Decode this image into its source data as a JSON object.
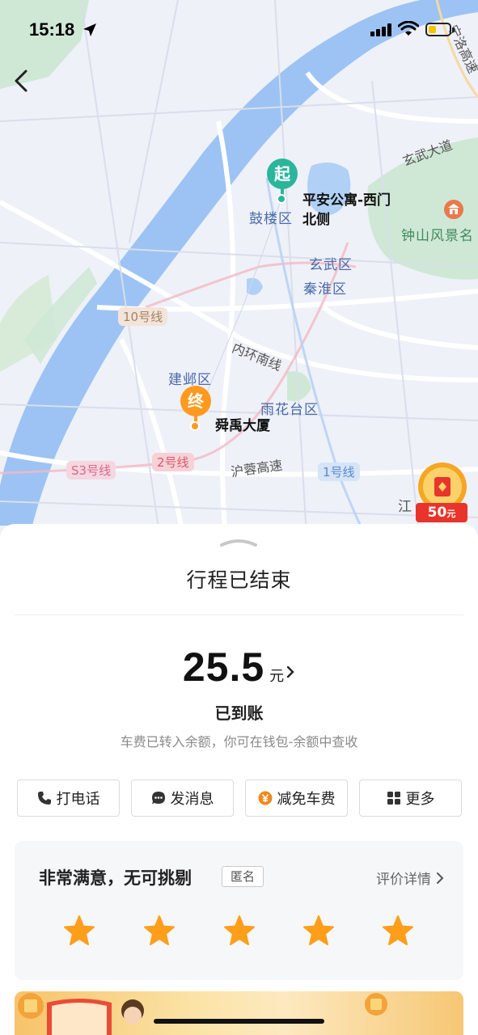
{
  "status_bar": {
    "time": "15:18"
  },
  "map": {
    "areas": [
      "鼓楼区",
      "玄武区",
      "秦淮区",
      "建邺区",
      "雨花台区"
    ],
    "scenic": [
      "钟山风景名"
    ],
    "roads": [
      "玄武大道",
      "内环南线",
      "沪蓉高速",
      "宁洛高速"
    ],
    "lines": [
      "10号线",
      "S3号线",
      "2号线",
      "1号线"
    ],
    "start": {
      "pin_label": "起",
      "name_line1": "平安公寓-西门",
      "name_line2": "北侧"
    },
    "end": {
      "pin_label": "终",
      "name": "舜禹大厦"
    },
    "edge_text": "江"
  },
  "coin_badge": {
    "amount": "50",
    "unit": "元"
  },
  "trip": {
    "title": "行程已结束",
    "amount": "25.5",
    "unit": "元",
    "status": "已到账",
    "note": "车费已转入余额，你可在钱包-余额中查收"
  },
  "actions": [
    {
      "label": "打电话",
      "icon": "phone-icon"
    },
    {
      "label": "发消息",
      "icon": "message-icon"
    },
    {
      "label": "减免车费",
      "icon": "yuan-coin-icon"
    },
    {
      "label": "更多",
      "icon": "grid-icon"
    }
  ],
  "rating": {
    "text": "非常满意，无可挑剔",
    "tag": "匿名",
    "detail_link": "评价详情",
    "stars": 5,
    "star_color": "#ff9e1b"
  },
  "colors": {
    "start_pin": "#2bb59a",
    "end_pin": "#ff9a1f",
    "badge_red": "#e8342a"
  }
}
